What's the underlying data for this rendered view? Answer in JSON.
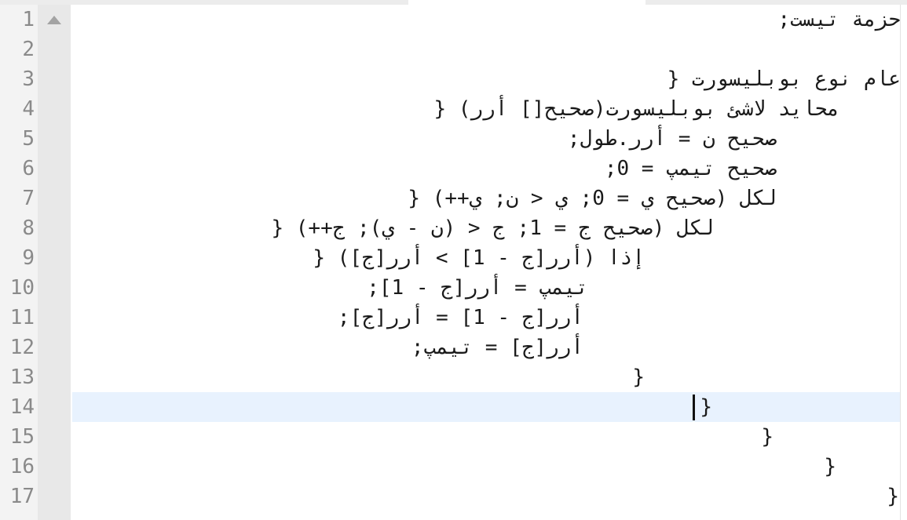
{
  "editor": {
    "lines": [
      {
        "number": "1",
        "text": "حزمة تيست;"
      },
      {
        "number": "2",
        "text": ""
      },
      {
        "number": "3",
        "text": "عام نوع بوبليسورت {"
      },
      {
        "number": "4",
        "text": "محايد لاشئ بوبليسورت(صحيح[] أرر) {"
      },
      {
        "number": "5",
        "text": "صحيح ن = أرر.طول;"
      },
      {
        "number": "6",
        "text": "صحيح تيمپ = 0;"
      },
      {
        "number": "7",
        "text": "لكل (صحيح ي = 0; ي < ن; ي++) {"
      },
      {
        "number": "8",
        "text": "لكل (صحيح ج = 1; ج < (ن - ي); ج++) {"
      },
      {
        "number": "9",
        "text": "إذا (أرر[ج - 1] > أرر[ج]) {"
      },
      {
        "number": "10",
        "text": "تيمپ = أرر[ج - 1];"
      },
      {
        "number": "11",
        "text": "أرر[ج - 1] = أرر[ج];"
      },
      {
        "number": "12",
        "text": "أرر[ج] = تيمپ;"
      },
      {
        "number": "13",
        "text": "}"
      },
      {
        "number": "14",
        "text": "}"
      },
      {
        "number": "15",
        "text": "}"
      },
      {
        "number": "16",
        "text": "}"
      },
      {
        "number": "17",
        "text": "}"
      }
    ]
  }
}
